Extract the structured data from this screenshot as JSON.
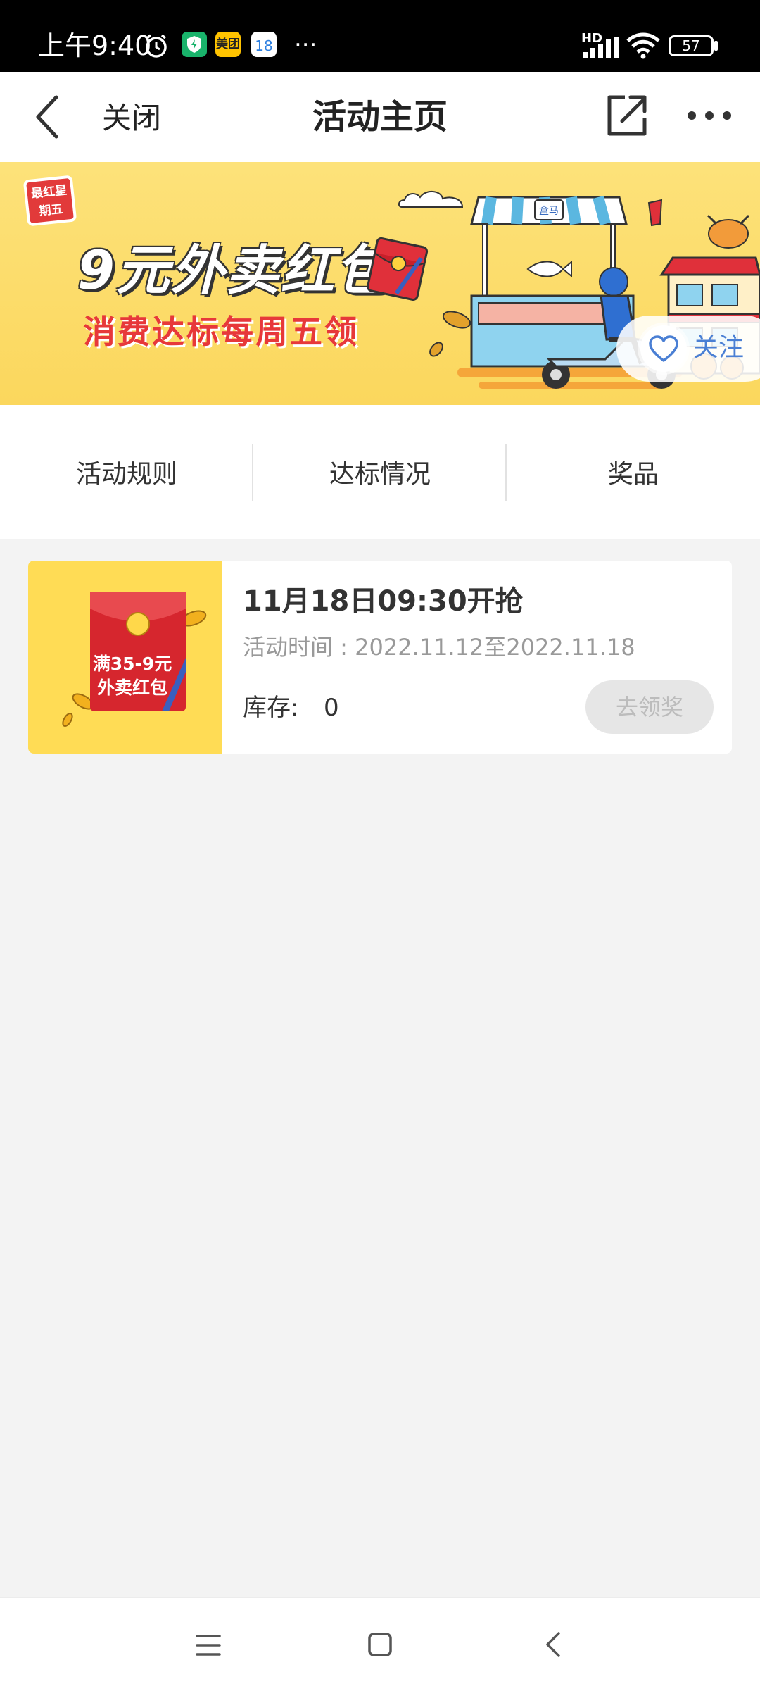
{
  "status_bar": {
    "time": "上午9:40",
    "app_icon_meituan": "美团",
    "calendar_day": "18",
    "more_dots": "···",
    "network_label": "HD",
    "battery": "57"
  },
  "nav": {
    "close_label": "关闭",
    "title": "活动主页"
  },
  "banner": {
    "badge": "最红星期五",
    "headline": "9元外卖红包",
    "subline": "消费达标每周五领",
    "follow_label": "关注"
  },
  "tabs": [
    {
      "label": "活动规则"
    },
    {
      "label": "达标情况"
    },
    {
      "label": "奖品"
    }
  ],
  "card": {
    "image_text_line1": "满35-9元",
    "image_text_line2": "外卖红包",
    "title": "11月18日09:30开抢",
    "time_label": "活动时间 : 2022.11.12至2022.11.18",
    "stock_label": "库存:",
    "stock_value": "0",
    "button_label": "去领奖"
  },
  "colors": {
    "banner_yellow": "#fbd75d",
    "accent_blue": "#4a7fd4",
    "red_packet": "#d6262e"
  }
}
